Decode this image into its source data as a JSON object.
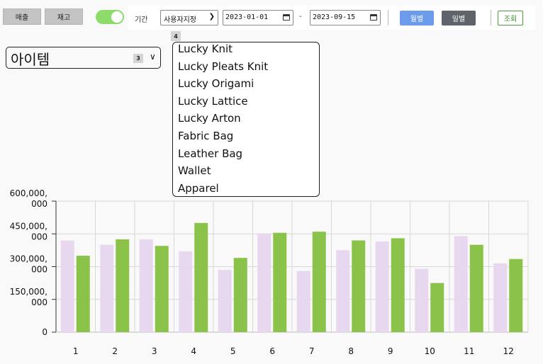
{
  "tabs": [
    {
      "label": "매출"
    },
    {
      "label": "재고"
    }
  ],
  "toolbar": {
    "period_label": "기간",
    "period_select": "사용자지정",
    "start_date": "2023-01-01",
    "end_date": "2023-09-15",
    "date_separator": "-",
    "monthly_button": "월별",
    "daily_button": "일별",
    "search_button": "조회",
    "toggle_on": true
  },
  "badges": {
    "dropdown_badge": "4",
    "item_badge": "3"
  },
  "item_select": {
    "title": "아이템"
  },
  "dropdown": {
    "options": [
      "Lucky Knit",
      "Lucky Pleats Knit",
      "Lucky Origami",
      "Lucky Lattice",
      "Lucky Arton",
      "Fabric Bag",
      "Leather Bag",
      "Wallet",
      "Apparel"
    ]
  },
  "colors": {
    "series_a": "#e8d8ef",
    "series_b": "#8bc34a",
    "month_button": "#6b9bea",
    "day_button": "#5e6469",
    "search_border": "#4a9b3a",
    "toggle": "#8ddc6a"
  },
  "chart_data": {
    "type": "bar",
    "categories": [
      "1",
      "2",
      "3",
      "4",
      "5",
      "6",
      "7",
      "8",
      "9",
      "10",
      "11",
      "12"
    ],
    "series": [
      {
        "values": [
          420000,
          400000,
          425000,
          370000,
          285000,
          450000,
          280000,
          375000,
          415000,
          290000,
          440000,
          315000
        ]
      },
      {
        "values": [
          350000,
          425000,
          395000,
          500000,
          340000,
          455000,
          460000,
          420000,
          430000,
          225000,
          400000,
          335000
        ]
      }
    ],
    "ylim": [
      0,
      600000
    ],
    "yticks": [
      {
        "value": 0,
        "lines": [
          "0"
        ]
      },
      {
        "value": 150000,
        "lines": [
          "150,000,",
          "000"
        ]
      },
      {
        "value": 300000,
        "lines": [
          "300,000,",
          "000"
        ]
      },
      {
        "value": 450000,
        "lines": [
          "450,000,",
          "000"
        ]
      },
      {
        "value": 600000,
        "lines": [
          "600,000,",
          "000"
        ]
      }
    ],
    "grid": true
  }
}
